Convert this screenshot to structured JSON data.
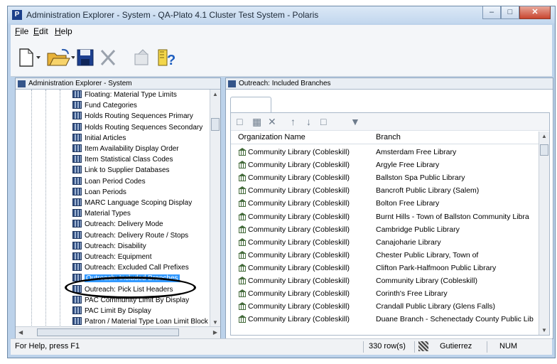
{
  "window": {
    "title": "Administration Explorer - System - QA-Plato 4.1 Cluster Test System - Polaris"
  },
  "menu": [
    {
      "label": "File",
      "key": "F",
      "rest": "ile"
    },
    {
      "label": "Edit",
      "key": "E",
      "rest": "dit"
    },
    {
      "label": "Help",
      "key": "H",
      "rest": "elp"
    }
  ],
  "toolbar": {
    "icons": [
      "new-icon",
      "open-folder-icon",
      "save-icon",
      "delete-icon",
      "properties-icon",
      "help-icon"
    ]
  },
  "left_panel": {
    "header": "Administration Explorer - System",
    "items": [
      "Floating: Material Type Limits",
      "Fund Categories",
      "Holds Routing Sequences Primary",
      "Holds Routing Sequences Secondary",
      "Initial Articles",
      "Item Availability Display Order",
      "Item Statistical Class Codes",
      "Link to Supplier Databases",
      "Loan Period Codes",
      "Loan Periods",
      "MARC Language Scoping Display",
      "Material Types",
      "Outreach: Delivery Mode",
      "Outreach: Delivery Route / Stops",
      "Outreach: Disability",
      "Outreach: Equipment",
      "Outreach: Excluded Call Prefixes",
      "Outreach: Included Branches",
      "Outreach: Pick List Headers",
      "PAC Community Limit By Display",
      "PAC Limit By Display",
      "Patron / Material Type Loan Limit Block"
    ],
    "selected_index": 17
  },
  "right_panel": {
    "header": "Outreach: Included Branches",
    "columns": [
      "Organization Name",
      "Branch"
    ],
    "rows": [
      {
        "org": "Community Library (Cobleskill)",
        "branch": "Amsterdam Free Library"
      },
      {
        "org": "Community Library (Cobleskill)",
        "branch": "Argyle Free Library"
      },
      {
        "org": "Community Library (Cobleskill)",
        "branch": "Ballston Spa Public Library"
      },
      {
        "org": "Community Library (Cobleskill)",
        "branch": "Bancroft Public Library (Salem)"
      },
      {
        "org": "Community Library (Cobleskill)",
        "branch": "Bolton Free Library"
      },
      {
        "org": "Community Library (Cobleskill)",
        "branch": "Burnt Hills - Town of Ballston Community Libra"
      },
      {
        "org": "Community Library (Cobleskill)",
        "branch": "Cambridge Public Library"
      },
      {
        "org": "Community Library (Cobleskill)",
        "branch": "Canajoharie Library"
      },
      {
        "org": "Community Library (Cobleskill)",
        "branch": "Chester Public Library, Town of"
      },
      {
        "org": "Community Library (Cobleskill)",
        "branch": "Clifton Park-Halfmoon Public Library"
      },
      {
        "org": "Community Library (Cobleskill)",
        "branch": "Community Library (Cobleskill)"
      },
      {
        "org": "Community Library (Cobleskill)",
        "branch": "Corinth's Free Library"
      },
      {
        "org": "Community Library (Cobleskill)",
        "branch": "Crandall Public Library (Glens Falls)"
      },
      {
        "org": "Community Library (Cobleskill)",
        "branch": "Duane Branch - Schenectady County Public Lib"
      }
    ]
  },
  "status": {
    "help": "For Help, press F1",
    "rows": "330 row(s)",
    "user": "Gutierrez",
    "num": "NUM"
  }
}
